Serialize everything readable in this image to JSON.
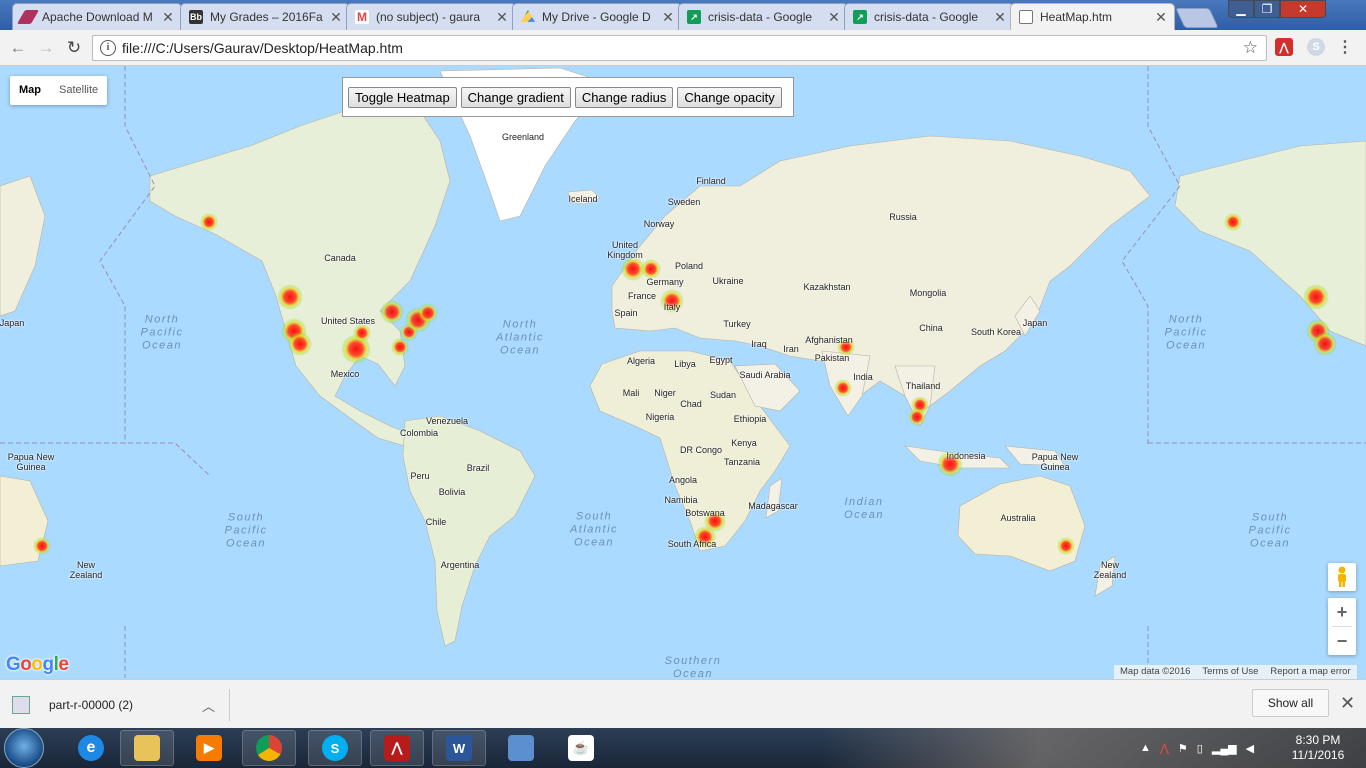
{
  "browser": {
    "tabs": [
      {
        "title": "Apache Download M",
        "icon": "apache-feather-icon"
      },
      {
        "title": "My Grades – 2016Fa",
        "icon": "blackboard-icon"
      },
      {
        "title": "(no subject) - gaura",
        "icon": "gmail-icon"
      },
      {
        "title": "My Drive - Google D",
        "icon": "google-drive-icon"
      },
      {
        "title": "crisis-data - Google",
        "icon": "google-sheets-icon"
      },
      {
        "title": "crisis-data - Google",
        "icon": "google-sheets-icon"
      },
      {
        "title": "HeatMap.htm",
        "icon": "document-icon"
      }
    ],
    "active_tab_index": 6,
    "url": "file:///C:/Users/Gaurav/Desktop/HeatMap.htm"
  },
  "map": {
    "type_controls": {
      "map": "Map",
      "satellite": "Satellite",
      "selected": "Map"
    },
    "heatmap_controls": {
      "toggle": "Toggle Heatmap",
      "gradient": "Change gradient",
      "radius": "Change radius",
      "opacity": "Change opacity"
    },
    "country_labels": [
      "Greenland",
      "Iceland",
      "Finland",
      "Sweden",
      "Norway",
      "Russia",
      "United Kingdom",
      "Germany",
      "Poland",
      "France",
      "Ukraine",
      "Kazakhstan",
      "Mongolia",
      "Spain",
      "Italy",
      "Turkey",
      "China",
      "South Korea",
      "Japan",
      "Canada",
      "United States",
      "Mexico",
      "Algeria",
      "Libya",
      "Egypt",
      "Iraq",
      "Iran",
      "Afghanistan",
      "Pakistan",
      "India",
      "Thailand",
      "Saudi Arabia",
      "Mali",
      "Niger",
      "Chad",
      "Sudan",
      "Ethiopia",
      "Nigeria",
      "Kenya",
      "DR Congo",
      "Tanzania",
      "Angola",
      "Namibia",
      "Botswana",
      "Madagascar",
      "South Africa",
      "Venezuela",
      "Colombia",
      "Brazil",
      "Peru",
      "Bolivia",
      "Chile",
      "Argentina",
      "Indonesia",
      "Papua New Guinea",
      "Australia",
      "New Zealand"
    ],
    "ocean_labels": [
      "North Pacific Ocean",
      "North Atlantic Ocean",
      "South Pacific Ocean",
      "South Atlantic Ocean",
      "Indian Ocean",
      "Southern Ocean"
    ],
    "logo": "Google",
    "attribution": {
      "data": "Map data ©2016",
      "terms": "Terms of Use",
      "report": "Report a map error"
    },
    "zoom_in": "+",
    "zoom_out": "−"
  },
  "downloads_bar": {
    "file_name": "part-r-00000 (2)",
    "show_all": "Show all"
  },
  "taskbar": {
    "pinned_apps": [
      "internet-explorer-icon",
      "file-explorer-icon",
      "media-player-icon",
      "chrome-icon",
      "skype-icon",
      "acrobat-icon",
      "word-icon",
      "virtualbox-icon",
      "java-icon"
    ],
    "time": "8:30 PM",
    "date": "11/1/2016"
  }
}
